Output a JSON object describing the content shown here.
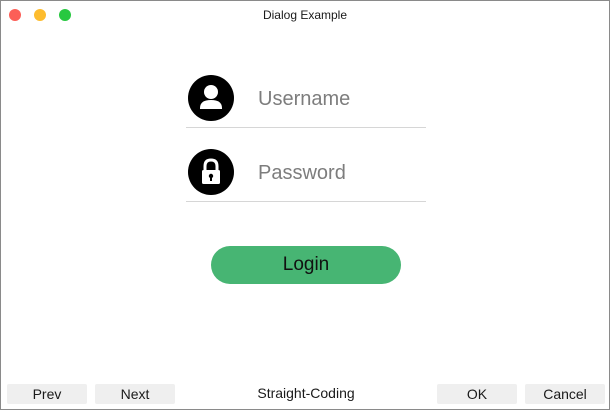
{
  "window": {
    "title": "Dialog Example",
    "traffic_lights": {
      "close_color": "#fc5f57",
      "minimize_color": "#fdbc2e",
      "maximize_color": "#28c840"
    }
  },
  "form": {
    "username": {
      "icon": "user-icon",
      "placeholder": "Username",
      "value": ""
    },
    "password": {
      "icon": "lock-icon",
      "placeholder": "Password",
      "value": ""
    },
    "login_label": "Login",
    "login_color": "#47b573"
  },
  "footer": {
    "prev_label": "Prev",
    "next_label": "Next",
    "brand_label": "Straight-Coding",
    "ok_label": "OK",
    "cancel_label": "Cancel"
  }
}
